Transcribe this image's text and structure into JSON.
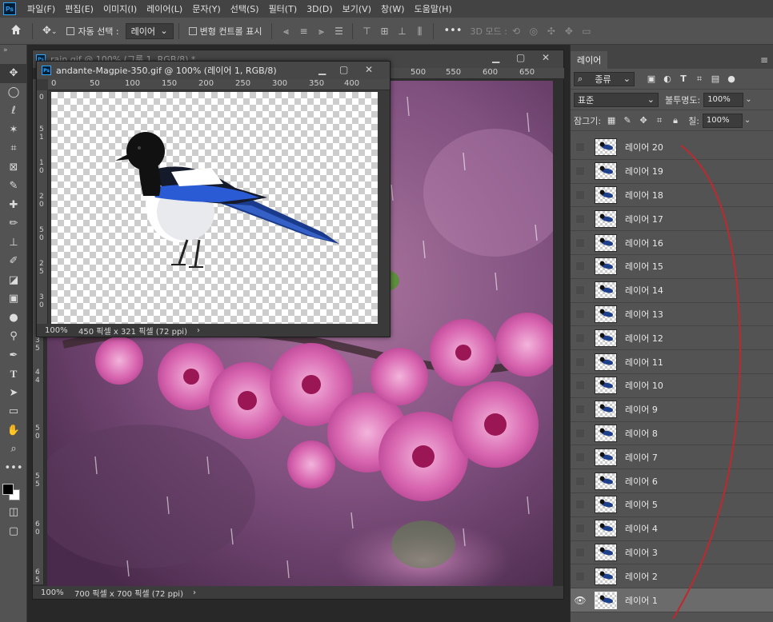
{
  "menu": [
    "파일(F)",
    "편집(E)",
    "이미지(I)",
    "레이어(L)",
    "문자(Y)",
    "선택(S)",
    "필터(T)",
    "3D(D)",
    "보기(V)",
    "창(W)",
    "도움말(H)"
  ],
  "app_logo": "Ps",
  "options": {
    "auto_select_label": "자동 선택 :",
    "auto_select_value": "레이어",
    "transform_label": "변형 컨트롤 표시",
    "more": "•••",
    "mode_3d_label": "3D 모드 :"
  },
  "doc_rain": {
    "title": "rain.gif @ 100% (그룹 1, RGB/8) *",
    "ruler_ticks": [
      "500",
      "550",
      "600",
      "650"
    ],
    "ruler_v": [
      "3",
      "5",
      "4",
      "4",
      "5",
      "0",
      "5",
      "5",
      "6",
      "0",
      "6",
      "5"
    ],
    "zoom": "100%",
    "info": "700 픽셀 x 700 픽셀 (72 ppi)"
  },
  "doc_magpie": {
    "title": "andante-Magpie-350.gif @ 100% (레이어 1, RGB/8)",
    "ruler_ticks": [
      "0",
      "50",
      "100",
      "150",
      "200",
      "250",
      "300",
      "350",
      "400"
    ],
    "ruler_v": [
      "0",
      "5",
      "1",
      "1",
      "0",
      "2",
      "0",
      "5",
      "0",
      "2",
      "5",
      "3",
      "0"
    ],
    "zoom": "100%",
    "info": "450 픽셀 x 321 픽셀 (72 ppi)"
  },
  "panel": {
    "tab": "레이어",
    "filter_kind": "종류",
    "blend_mode": "표준",
    "opacity_label": "불투명도:",
    "opacity_value": "100%",
    "lock_label": "잠그기:",
    "fill_label": "칠:",
    "fill_value": "100%",
    "layers": [
      "레이어 20",
      "레이어 19",
      "레이어 18",
      "레이어 17",
      "레이어 16",
      "레이어 15",
      "레이어 14",
      "레이어 13",
      "레이어 12",
      "레이어 11",
      "레이어 10",
      "레이어 9",
      "레이어 8",
      "레이어 7",
      "레이어 6",
      "레이어 5",
      "레이어 4",
      "레이어 3",
      "레이어 2",
      "레이어 1"
    ],
    "selected_layer": "레이어 1"
  },
  "colors": {
    "annotation_red": "#c0282d",
    "ps_blue": "#31a8ff"
  }
}
